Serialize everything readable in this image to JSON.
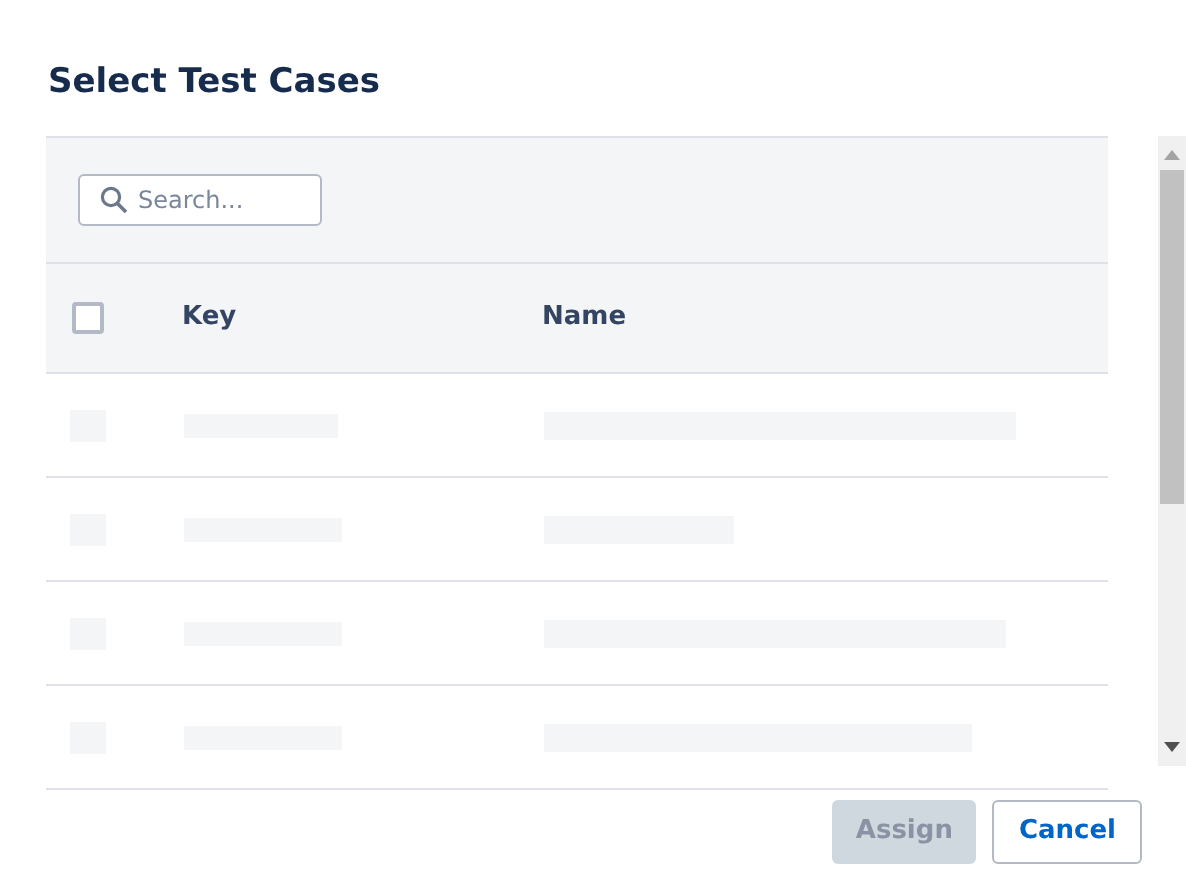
{
  "dialog": {
    "title": "Select Test Cases"
  },
  "search": {
    "placeholder": "Search..."
  },
  "table": {
    "select_all": {
      "checked": false
    },
    "columns": [
      "Key",
      "Name"
    ],
    "rows": [
      {
        "kind": "placeholder"
      },
      {
        "kind": "placeholder"
      },
      {
        "kind": "placeholder"
      },
      {
        "kind": "placeholder"
      }
    ]
  },
  "buttons": [
    {
      "label": "Assign",
      "disabled": true
    },
    {
      "label": "Cancel",
      "disabled": false
    }
  ]
}
